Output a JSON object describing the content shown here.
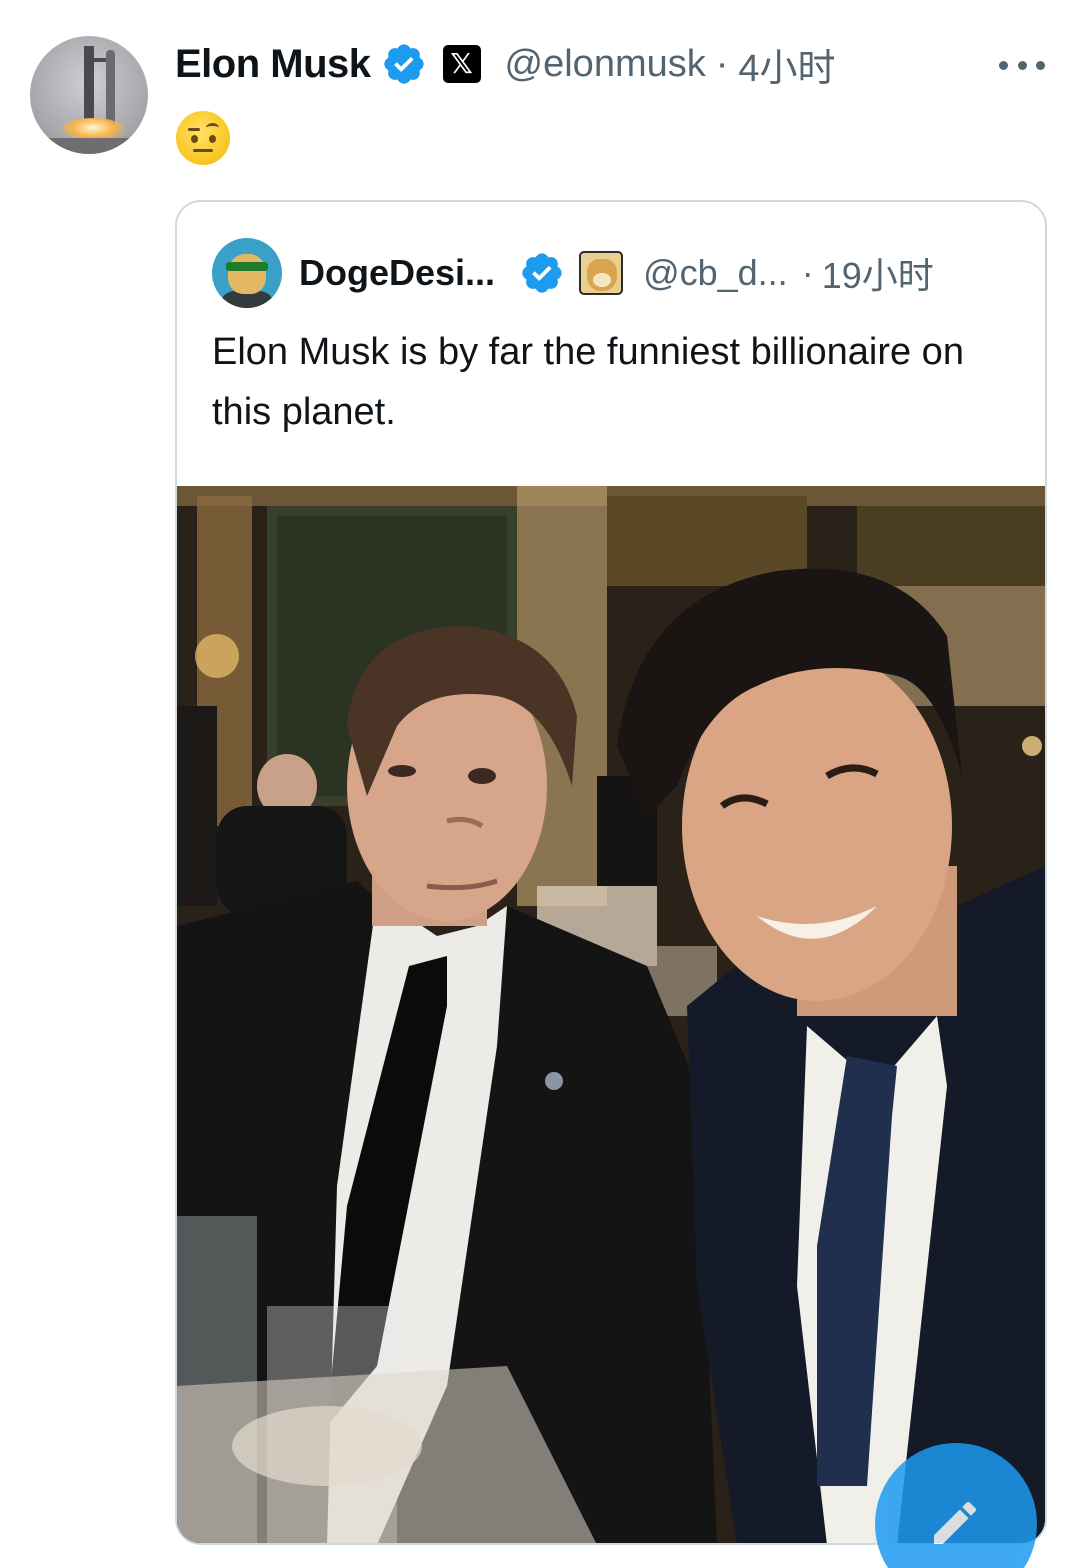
{
  "tweet": {
    "author_name": "Elon Musk",
    "author_handle": "@elonmusk",
    "separator": "·",
    "time": "4小时",
    "platform_badge": "𝕏",
    "content_emoji": "face-with-raised-eyebrow",
    "verified_color": "#1d9bf0"
  },
  "quoted_tweet": {
    "author_name": "DogeDesi...",
    "author_handle": "@cb_d...",
    "separator": "·",
    "time": "19小时",
    "text": "Elon Musk is by far the funniest billionaire on this planet.",
    "media": "photo-two-men-at-banquet"
  },
  "actions": {
    "more_icon": "more-horizontal-icon",
    "compose_icon": "compose-icon"
  }
}
